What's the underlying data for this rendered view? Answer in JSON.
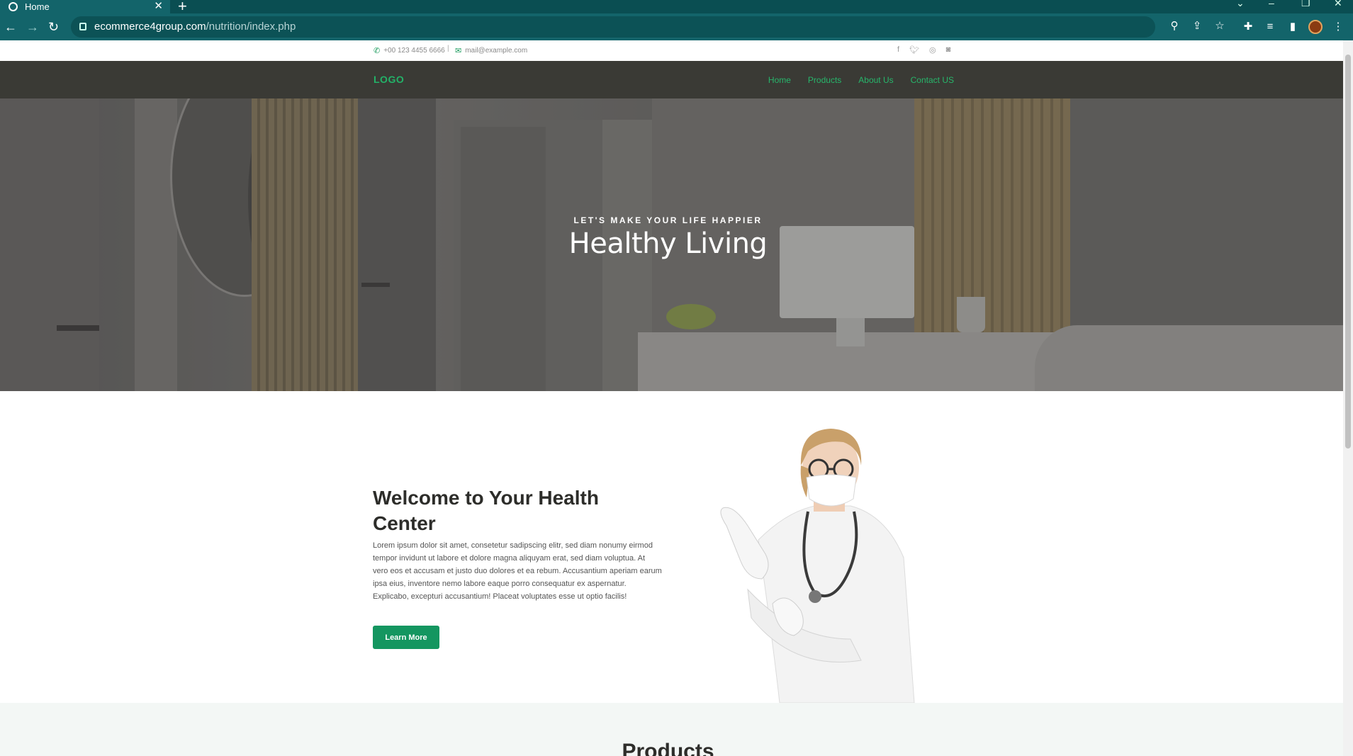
{
  "browser": {
    "tab_title": "Home",
    "url_host": "ecommerce4group.com",
    "url_path": "/nutrition/index.php"
  },
  "topbar": {
    "phone": "+00 123 4455 6666",
    "separator": "|",
    "email": "mail@example.com",
    "socials": [
      "facebook-icon",
      "twitter-icon",
      "dribbble-icon",
      "instagram-icon"
    ]
  },
  "nav": {
    "logo": "LOGO",
    "items": [
      {
        "label": "Home"
      },
      {
        "label": "Products"
      },
      {
        "label": "About Us"
      },
      {
        "label": "Contact US"
      }
    ]
  },
  "hero": {
    "kicker": "LET'S MAKE YOUR LIFE HAPPIER",
    "title": "Healthy Living"
  },
  "welcome": {
    "title": "Welcome to Your Health Center",
    "text": "Lorem ipsum dolor sit amet, consetetur sadipscing elitr, sed diam nonumy eirmod tempor invidunt ut labore et dolore magna aliquyam erat, sed diam voluptua. At vero eos et accusam et justo duo dolores et ea rebum. Accusantium aperiam earum ipsa eius, inventore nemo labore eaque porro consequatur ex aspernatur. Explicabo, excepturi accusantium! Placeat voluptates esse ut optio facilis!",
    "button": "Learn More"
  },
  "products": {
    "title": "Products"
  },
  "colors": {
    "accent": "#149660",
    "nav_bg": "#3a3a35",
    "chrome": "#13646a"
  }
}
